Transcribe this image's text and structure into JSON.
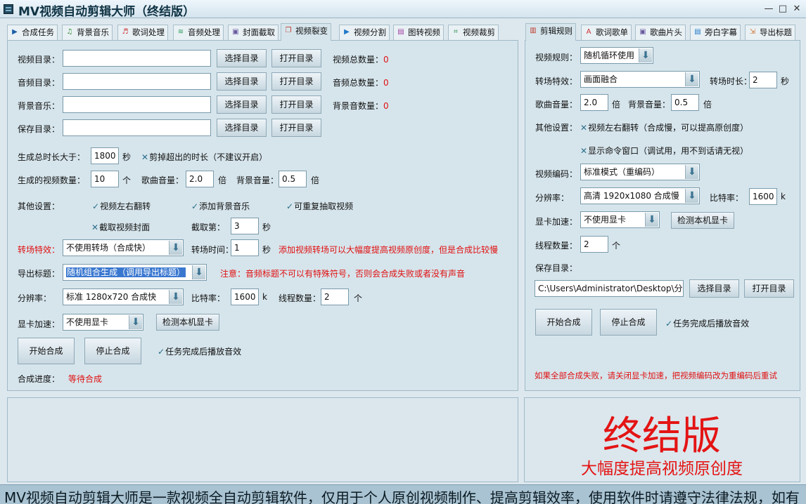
{
  "window": {
    "title": "MV视频自动剪辑大师（终结版）",
    "minimize": "—",
    "maximize": "□",
    "close": "✕"
  },
  "left_tabs": [
    "合成任务",
    "背景音乐",
    "歌词处理",
    "音频处理",
    "封面截取",
    "视频裂变",
    "视频分割",
    "图转视频",
    "视频裁剪"
  ],
  "right_tabs": [
    "剪辑规则",
    "歌词歌单",
    "歌曲片头",
    "旁白字幕",
    "导出标题"
  ],
  "left": {
    "video_dir_label": "视频目录：",
    "audio_dir_label": "音频目录：",
    "bgm_label": "背景音乐：",
    "save_dir_label": "保存目录：",
    "video_dir_value": "",
    "audio_dir_value": "",
    "bgm_value": "",
    "save_dir_value": "",
    "select_dir": "选择目录",
    "open_dir": "打开目录",
    "video_total_label": "视频总数量：",
    "video_total": "0",
    "audio_total_label": "音频总数量：",
    "audio_total": "0",
    "bgm_total_label": "背景音数量：",
    "bgm_total": "0",
    "gen_duration_label": "生成总时长大于：",
    "gen_duration": "1800",
    "sec": "秒",
    "trim_excess": "剪掉超出的时长（不建议开启）",
    "gen_count_label": "生成的视频数量：",
    "gen_count": "10",
    "unit_ge": "个",
    "song_vol_label": "歌曲音量：",
    "song_vol": "2.0",
    "bei": "倍",
    "bg_vol_label": "背景音量：",
    "bg_vol": "0.5",
    "other_label": "其他设置：",
    "flip": "视频左右翻转",
    "add_bgm": "添加背景音乐",
    "repeat_extract": "可重复抽取视频",
    "cover": "截取视频封面",
    "cut_label": "截取第：",
    "cut_value": "3",
    "transition_label": "转场特效：",
    "transition_value": "不使用转场（合成快）",
    "transition_time_label": "转场时间：",
    "transition_time": "1",
    "transition_note": "添加视频转场可以大幅度提高视频原创度，但是合成比较慢",
    "export_title_label": "导出标题：",
    "export_title_value": "随机组合生成（调用导出标题）",
    "export_note": "注意：音频标题不可以有特殊符号，否则会合成失败或者没有声音",
    "res_label": "分辨率：",
    "res_value": "标准 1280x720  合成快",
    "bitrate_label": "比特率：",
    "bitrate": "1600",
    "k": "k",
    "threads_label": "线程数量：",
    "threads": "2",
    "gpu_label": "显卡加速：",
    "gpu_value": "不使用显卡",
    "detect_gpu": "检测本机显卡",
    "start": "开始合成",
    "stop": "停止合成",
    "play_sound": "任务完成后播放音效",
    "progress_label": "合成进度：",
    "progress_value": "等待合成"
  },
  "right": {
    "rule_label": "视频规则：",
    "rule_value": "随机循环使用",
    "transition_label": "转场特效：",
    "transition_value": "画面融合",
    "transition_len_label": "转场时长：",
    "transition_len": "2",
    "sec": "秒",
    "song_vol_label": "歌曲音量：",
    "song_vol": "2.0",
    "bei": "倍",
    "bg_vol_label": "背景音量：",
    "bg_vol": "0.5",
    "other_label": "其他设置：",
    "flip": "视频左右翻转（合成慢，可以提高原创度）",
    "show_cmd": "显示命令窗口（调试用，用不到话请无视）",
    "encode_label": "视频编码：",
    "encode_value": "标准模式（重编码）",
    "res_label": "分辨率：",
    "res_value": "高清 1920x1080 合成慢",
    "bitrate_label": "比特率：",
    "bitrate": "1600",
    "k": "k",
    "gpu_label": "显卡加速：",
    "gpu_value": "不使用显卡",
    "detect_gpu": "检测本机显卡",
    "threads_label": "线程数量：",
    "threads": "2",
    "unit_ge": "个",
    "save_label": "保存目录：",
    "save_value": "C:\\Users\\Administrator\\Desktop\\分",
    "select_dir": "选择目录",
    "open_dir": "打开目录",
    "start": "开始合成",
    "stop": "停止合成",
    "play_sound": "任务完成后播放音效",
    "fail_note": "如果全部合成失败，请关闭显卡加速，把视频编码改为重编码后重试"
  },
  "ad": {
    "big": "终结版",
    "sub": "大幅度提高视频原创度"
  },
  "marquee": "MV视频自动剪辑大师是一款视频全自动剪辑软件，仅用于个人原创视频制作、提高剪辑效率，使用软件时请遵守法律法规，如有",
  "colors": {
    "accent_red": "#e01010",
    "panel": "#d6e5ec",
    "title": "#0f3344"
  }
}
